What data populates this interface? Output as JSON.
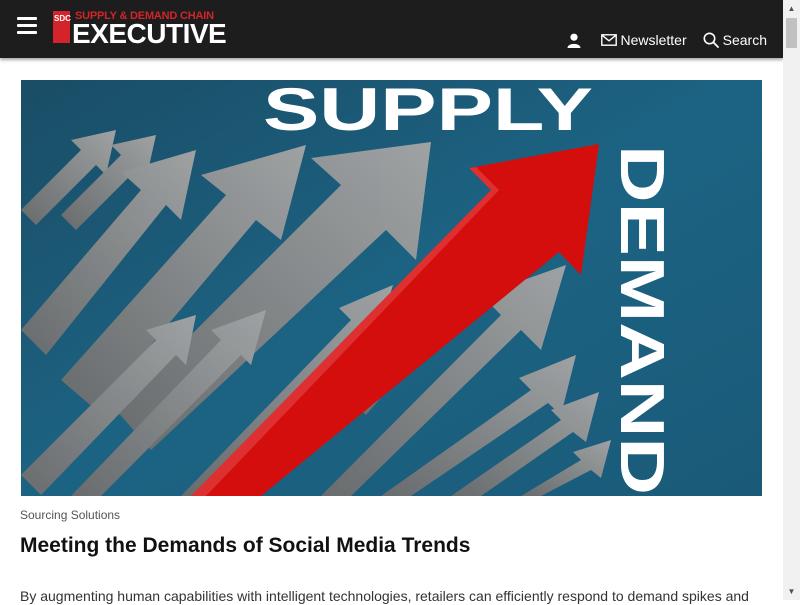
{
  "header": {
    "logo": {
      "badge_text": "SDC",
      "top_text": "SUPPLY & DEMAND CHAIN",
      "main_text": "EXECUTIVE"
    },
    "nav": {
      "account_icon": "user-icon",
      "newsletter_icon": "envelope-icon",
      "newsletter_label": "Newsletter",
      "search_icon": "magnifier-icon",
      "search_label": "Search"
    },
    "menu_icon": "hamburger-icon"
  },
  "hero": {
    "word_top": "SUPPLY",
    "word_side": "DEMAND",
    "colors": {
      "background": "#1c5f7e",
      "arrow_red": "#d40d0d",
      "arrow_gray": "#8e8e8e",
      "text": "#ffffff"
    }
  },
  "article": {
    "category": "Sourcing Solutions",
    "title": "Meeting the Demands of Social Media Trends",
    "summary": "By augmenting human capabilities with intelligent technologies, retailers can efficiently respond to demand spikes and"
  },
  "colors": {
    "topbar": "#1d1d1d",
    "brand_red": "#d3242b"
  }
}
